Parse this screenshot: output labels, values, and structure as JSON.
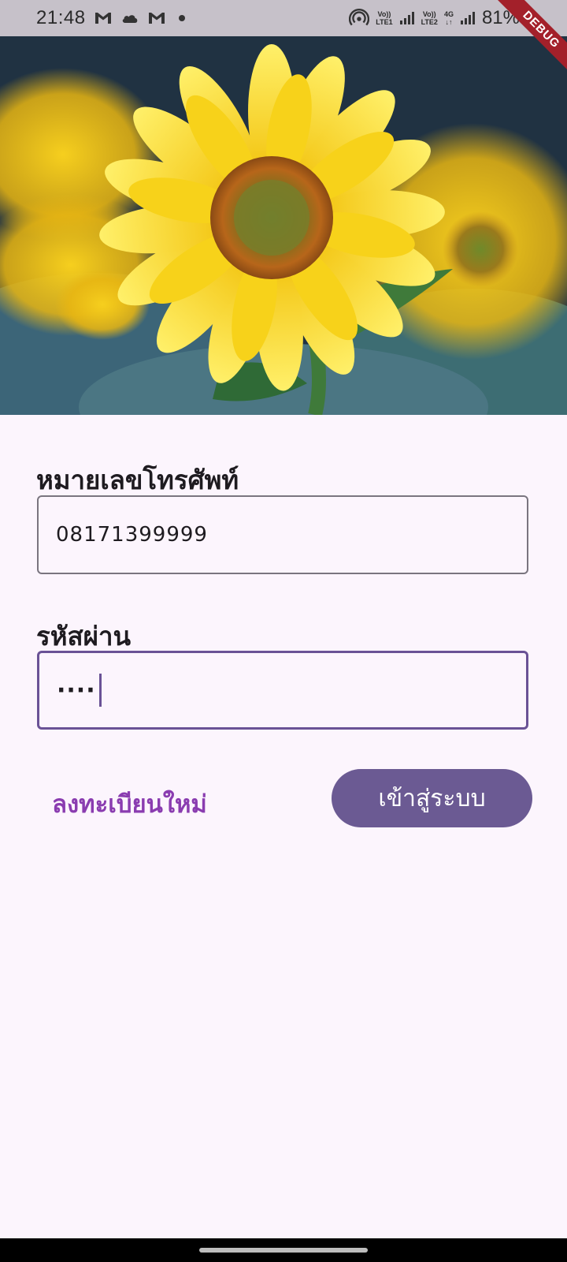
{
  "status_bar": {
    "time": "21:48",
    "notification_icons": [
      "gmail-icon",
      "cloud-icon",
      "gmail-icon"
    ],
    "volte1": "Vo))",
    "lte1": "LTE1",
    "volte2": "Vo))",
    "lte2": "LTE2",
    "network": "4G",
    "battery": "81%",
    "debug_label": "DEBUG"
  },
  "hero": {
    "icon": "sunflower-image"
  },
  "form": {
    "phone_label": "หมายเลขโทรศัพท์",
    "phone_value": "08171399999",
    "password_label": "รหัสผ่าน",
    "password_masked": "····",
    "register_label": "ลงทะเบียนใหม่",
    "login_label": "เข้าสู่ระบบ"
  },
  "colors": {
    "background": "#fcf5fd",
    "accent": "#6b5a93",
    "link": "#8a3cb0",
    "focus_border": "#6a5296"
  }
}
